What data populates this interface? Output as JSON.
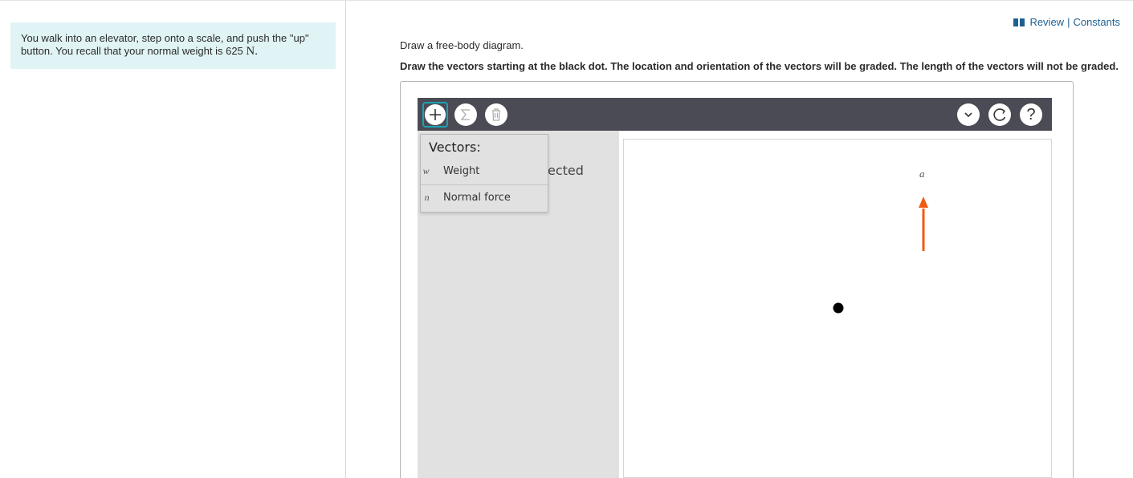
{
  "problem": {
    "text": "You walk into an elevator, step onto a scale, and push the \"up\" button. You recall that your normal weight is 625",
    "unit": "N."
  },
  "header_links": {
    "review": "Review",
    "separator": "|",
    "constants": "Constants"
  },
  "instructions": {
    "line1": "Draw a free-body diagram.",
    "line2": "Draw the vectors starting at the black dot. The location and orientation of the vectors will be graded. The length of the vectors will not be graded."
  },
  "toolbar": {
    "add_icon": "plus-icon",
    "sum_icon": "sigma-icon",
    "trash_icon": "trash-icon",
    "chevron_icon": "chevron-down-icon",
    "reset_icon": "reset-icon",
    "help_label": "?"
  },
  "side_panel": {
    "partial_text": "ected"
  },
  "vector_menu": {
    "title": "Vectors:",
    "items": [
      {
        "symbol": "w⃗",
        "label": "Weight"
      },
      {
        "symbol": "n⃗",
        "label": "Normal force"
      }
    ]
  },
  "canvas": {
    "acceleration_label": "a⃗",
    "acceleration_color": "#f05a14",
    "acceleration_direction": "up",
    "dot_color": "#000000"
  },
  "colors": {
    "problem_bg": "#e0f3f5",
    "link": "#1d5f91",
    "toolbar_bg": "#4b4b55",
    "selected_outline": "#1aa3b5"
  }
}
